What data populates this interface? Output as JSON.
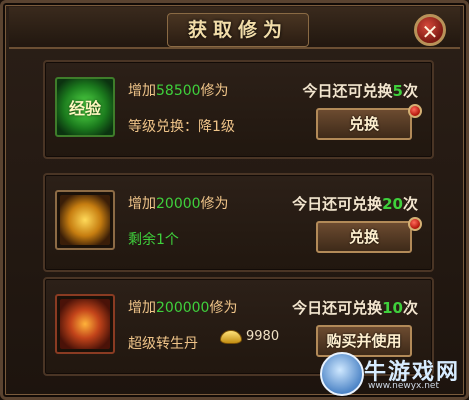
{
  "dialog": {
    "title": "获取修为",
    "close_symbol": "✕"
  },
  "items": [
    {
      "icon": "exp-icon",
      "icon_text": "经验",
      "line1_prefix": "增加",
      "line1_amount": "58500",
      "line1_suffix": "修为",
      "line2": "等级兑换：降1级",
      "count_prefix": "今日还可兑换",
      "count_value": "5",
      "count_suffix": "次",
      "button_label": "兑换",
      "has_notification_dot": true
    },
    {
      "icon": "gold-orb-icon",
      "line1_prefix": "增加",
      "line1_amount": "20000",
      "line1_suffix": "修为",
      "line2": "剩余1个",
      "count_prefix": "今日还可兑换",
      "count_value": "20",
      "count_suffix": "次",
      "button_label": "兑换",
      "has_notification_dot": true
    },
    {
      "icon": "rebirth-pill-icon",
      "line1_prefix": "增加",
      "line1_amount": "200000",
      "line1_suffix": "修为",
      "line2": "超级转生丹",
      "price": "9980",
      "currency_icon": "gold-ingot-icon",
      "count_prefix": "今日还可兑换",
      "count_value": "10",
      "count_suffix": "次",
      "button_label": "购买并使用",
      "has_notification_dot": false
    }
  ],
  "watermark": {
    "brand": "牛游戏网",
    "url": "www.newyx.net"
  },
  "colors": {
    "highlight_green": "#3fd03c",
    "label_gold": "#efc489",
    "title_text": "#f1dca8"
  }
}
